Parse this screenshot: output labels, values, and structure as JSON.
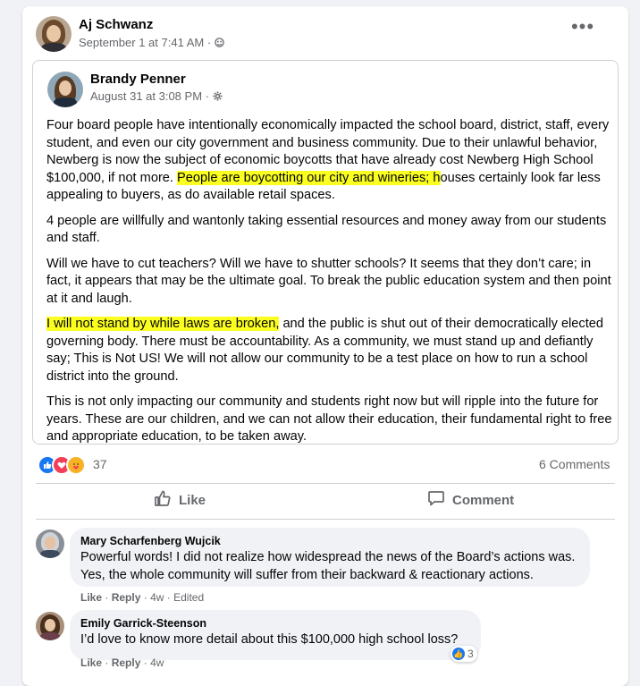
{
  "post": {
    "author": "Aj Schwanz",
    "time": "September 1 at 7:41 AM",
    "separator": "·",
    "audience_icon": "friends-icon",
    "more_icon": "more-horizontal-icon",
    "more_label": "•••"
  },
  "shared": {
    "author": "Brandy Penner",
    "time": "August 31 at 3:08 PM",
    "separator": "·",
    "audience_icon": "gear-icon",
    "p1_a": "Four board people have intentionally economically impacted the school board, district, staff, every student, and even our city government and business community. Due to their unlawful behavior, Newberg is now the subject of economic boycotts that have already cost Newberg High School $100,000, if not more. ",
    "p1_hl": "People are boycotting our city and wineries; h",
    "p1_b": "ouses certainly look far less appealing to buyers, as do available retail spaces.",
    "p2": "4 people are willfully and wantonly taking essential resources and money away from our students and staff.",
    "p3": "Will we have to cut teachers? Will we have to shutter schools? It seems that they don’t care; in fact, it appears that may be the ultimate goal. To break the public education system and then point at it and laugh.",
    "p4_hl": "I will not stand by while laws are broken,",
    "p4_b": " and the public is shut out of their democratically elected governing body. There must be accountability. As a community, we must stand up and defiantly say; This is Not US!  We will not allow our community to be a test place on how to run a school district into the ground.",
    "p5": "This is not only impacting our community and students right now but will ripple into the future for years. These are our children, and we can not allow their education, their fundamental right to free and appropriate education, to be taken away."
  },
  "reactions": {
    "icons": [
      "like-reaction-icon",
      "love-reaction-icon",
      "care-reaction-icon"
    ],
    "count": "37",
    "comments": "6 Comments"
  },
  "actions": {
    "like": "Like",
    "comment": "Comment"
  },
  "comments": [
    {
      "name": "Mary Scharfenberg Wujcik",
      "text": "Powerful words! I did not realize how widespread the news of the Board’s actions was. Yes, the whole community will suffer from their backward & reactionary actions.",
      "like": "Like",
      "reply": "Reply",
      "time": "4w",
      "edited": "Edited",
      "sep": "·"
    },
    {
      "name": "Emily Garrick-Steenson",
      "text": "I’d love to know more detail about this $100,000 high school loss?",
      "like": "Like",
      "reply": "Reply",
      "time": "4w",
      "sep": "·",
      "reaction_count": "3"
    }
  ],
  "colors": {
    "highlight": "#fbff1f",
    "like_blue": "#1877f2",
    "secondary_text": "#65676b"
  }
}
